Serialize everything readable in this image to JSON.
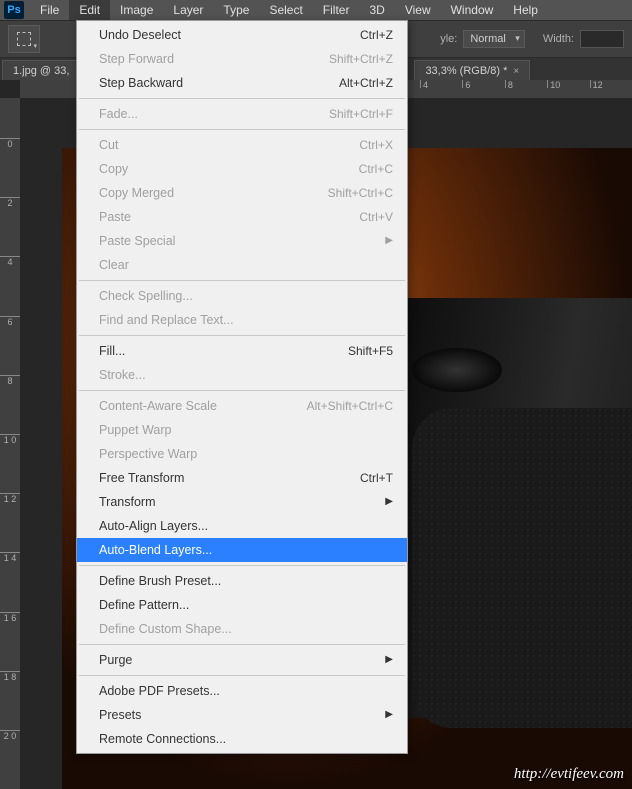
{
  "menubar": {
    "logo": "Ps",
    "items": [
      "File",
      "Edit",
      "Image",
      "Layer",
      "Type",
      "Select",
      "Filter",
      "3D",
      "View",
      "Window",
      "Help"
    ],
    "active_index": 1
  },
  "options_bar": {
    "style_label": "yle:",
    "style_value": "Normal",
    "width_label": "Width:"
  },
  "tabs": {
    "items": [
      {
        "label": "1.jpg @ 33,"
      },
      {
        "label": "33,3% (RGB/8) *"
      }
    ]
  },
  "ruler_h": [
    "4",
    "6",
    "8",
    "10",
    "12"
  ],
  "ruler_v": [
    "0",
    "2",
    "4",
    "6",
    "8",
    "1 0",
    "1 2",
    "1 4",
    "1 6",
    "1 8",
    "2 0"
  ],
  "edit_menu": {
    "groups": [
      [
        {
          "label": "Undo Deselect",
          "shortcut": "Ctrl+Z",
          "enabled": true
        },
        {
          "label": "Step Forward",
          "shortcut": "Shift+Ctrl+Z",
          "enabled": false
        },
        {
          "label": "Step Backward",
          "shortcut": "Alt+Ctrl+Z",
          "enabled": true
        }
      ],
      [
        {
          "label": "Fade...",
          "shortcut": "Shift+Ctrl+F",
          "enabled": false
        }
      ],
      [
        {
          "label": "Cut",
          "shortcut": "Ctrl+X",
          "enabled": false
        },
        {
          "label": "Copy",
          "shortcut": "Ctrl+C",
          "enabled": false
        },
        {
          "label": "Copy Merged",
          "shortcut": "Shift+Ctrl+C",
          "enabled": false
        },
        {
          "label": "Paste",
          "shortcut": "Ctrl+V",
          "enabled": false
        },
        {
          "label": "Paste Special",
          "submenu": true,
          "enabled": false
        },
        {
          "label": "Clear",
          "enabled": false
        }
      ],
      [
        {
          "label": "Check Spelling...",
          "enabled": false
        },
        {
          "label": "Find and Replace Text...",
          "enabled": false
        }
      ],
      [
        {
          "label": "Fill...",
          "shortcut": "Shift+F5",
          "enabled": true
        },
        {
          "label": "Stroke...",
          "enabled": false
        }
      ],
      [
        {
          "label": "Content-Aware Scale",
          "shortcut": "Alt+Shift+Ctrl+C",
          "enabled": false
        },
        {
          "label": "Puppet Warp",
          "enabled": false
        },
        {
          "label": "Perspective Warp",
          "enabled": false
        },
        {
          "label": "Free Transform",
          "shortcut": "Ctrl+T",
          "enabled": true
        },
        {
          "label": "Transform",
          "submenu": true,
          "enabled": true
        },
        {
          "label": "Auto-Align Layers...",
          "enabled": true
        },
        {
          "label": "Auto-Blend Layers...",
          "enabled": true,
          "highlight": true
        }
      ],
      [
        {
          "label": "Define Brush Preset...",
          "enabled": true
        },
        {
          "label": "Define Pattern...",
          "enabled": true
        },
        {
          "label": "Define Custom Shape...",
          "enabled": false
        }
      ],
      [
        {
          "label": "Purge",
          "submenu": true,
          "enabled": true
        }
      ],
      [
        {
          "label": "Adobe PDF Presets...",
          "enabled": true
        },
        {
          "label": "Presets",
          "submenu": true,
          "enabled": true
        },
        {
          "label": "Remote Connections...",
          "enabled": true
        }
      ]
    ]
  },
  "watermark": "http://evtifeev.com"
}
